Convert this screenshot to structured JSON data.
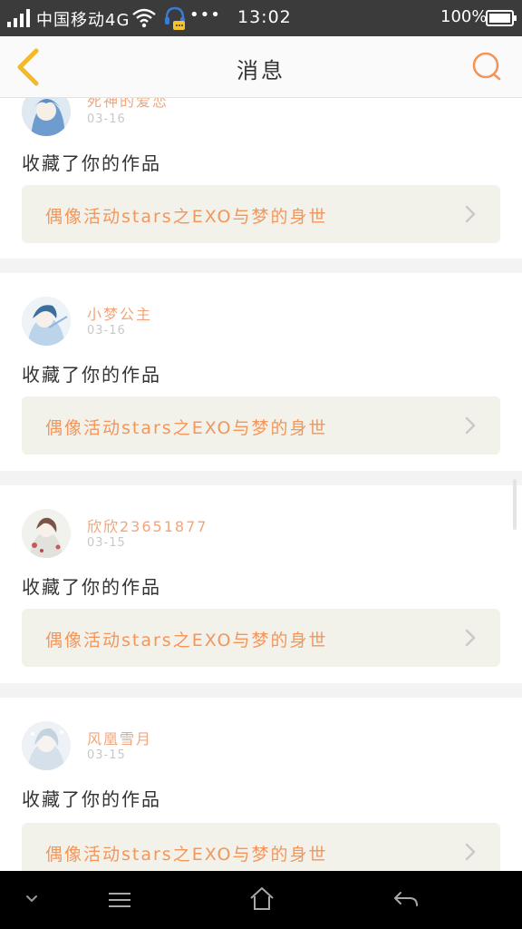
{
  "status_bar": {
    "carrier": "中国移动4G",
    "dots": "•••",
    "time": "13:02",
    "battery": "100%"
  },
  "header": {
    "title": "消息"
  },
  "colors": {
    "accent": "#f2965c",
    "username": "#f0a57a",
    "card_link_bg": "#f3f2ea",
    "back_icon": "#f2b928",
    "search_icon": "#f2965c"
  },
  "messages": [
    {
      "username": "死神的爱恋",
      "date": "03-16",
      "action": "收藏了你的作品",
      "work_title": "偶像活动stars之EXO与梦的身世"
    },
    {
      "username": "小梦公主",
      "date": "03-16",
      "action": "收藏了你的作品",
      "work_title": "偶像活动stars之EXO与梦的身世"
    },
    {
      "username": "欣欣23651877",
      "date": "03-15",
      "action": "收藏了你的作品",
      "work_title": "偶像活动stars之EXO与梦的身世"
    },
    {
      "username": "风凰雪月",
      "date": "03-15",
      "action": "收藏了你的作品",
      "work_title": "偶像活动stars之EXO与梦的身世"
    }
  ],
  "icons": {
    "back": "chevron-left-icon",
    "search": "search-icon",
    "link_arrow": "chevron-right-icon",
    "nav_down": "chevron-down-icon",
    "nav_menu": "menu-icon",
    "nav_home": "home-icon",
    "nav_back": "back-arrow-icon"
  }
}
